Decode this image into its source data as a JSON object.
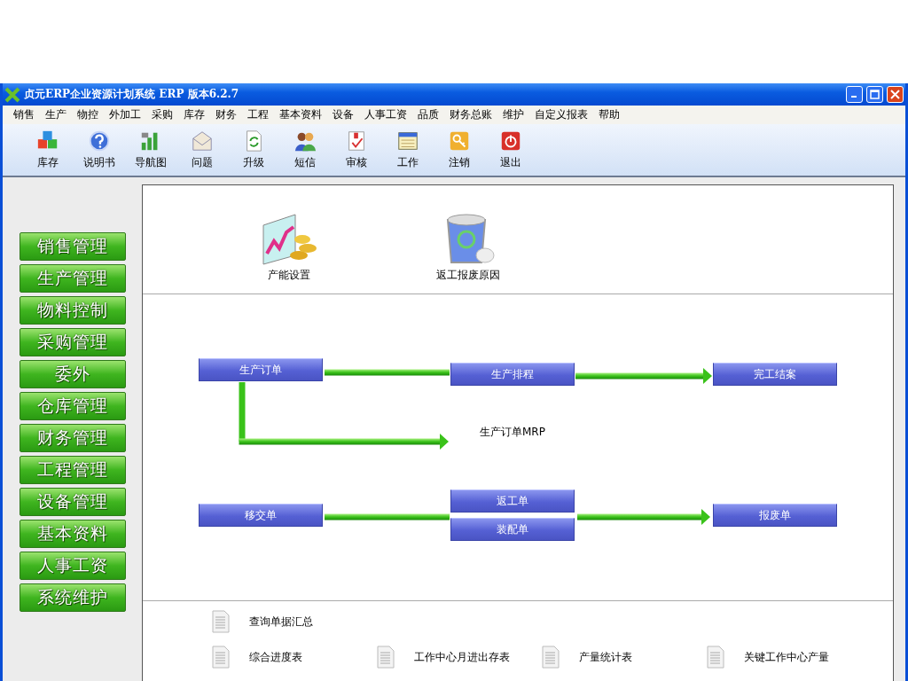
{
  "window": {
    "title": "贞元ERP企业资源计划系统 ERP 版本6.2.7"
  },
  "menu": [
    "销售",
    "生产",
    "物控",
    "外加工",
    "采购",
    "库存",
    "财务",
    "工程",
    "基本资料",
    "设备",
    "人事工资",
    "品质",
    "财务总账",
    "维护",
    "自定义报表",
    "帮助"
  ],
  "toolbar": [
    "库存",
    "说明书",
    "导航图",
    "问题",
    "升级",
    "短信",
    "审核",
    "工作",
    "注销",
    "退出"
  ],
  "sidebar": [
    "销售管理",
    "生产管理",
    "物料控制",
    "采购管理",
    "委外",
    "仓库管理",
    "财务管理",
    "工程管理",
    "设备管理",
    "基本资料",
    "人事工资",
    "系统维护"
  ],
  "shortcuts": [
    "产能设置",
    "返工报废原因"
  ],
  "flow": [
    {
      "label": "生产订单",
      "kind": "box"
    },
    {
      "label": "生产排程",
      "kind": "box"
    },
    {
      "label": "完工结案",
      "kind": "box"
    },
    {
      "label": "生产订单MRP",
      "kind": "text"
    },
    {
      "label": "移交单",
      "kind": "box"
    },
    {
      "label": "返工单",
      "kind": "box"
    },
    {
      "label": "装配单",
      "kind": "box"
    },
    {
      "label": "报废单",
      "kind": "box"
    }
  ],
  "reports": [
    [
      "查询单据汇总"
    ],
    [
      "综合进度表",
      "工作中心月进出存表",
      "产量统计表",
      "关键工作中心产量"
    ]
  ]
}
